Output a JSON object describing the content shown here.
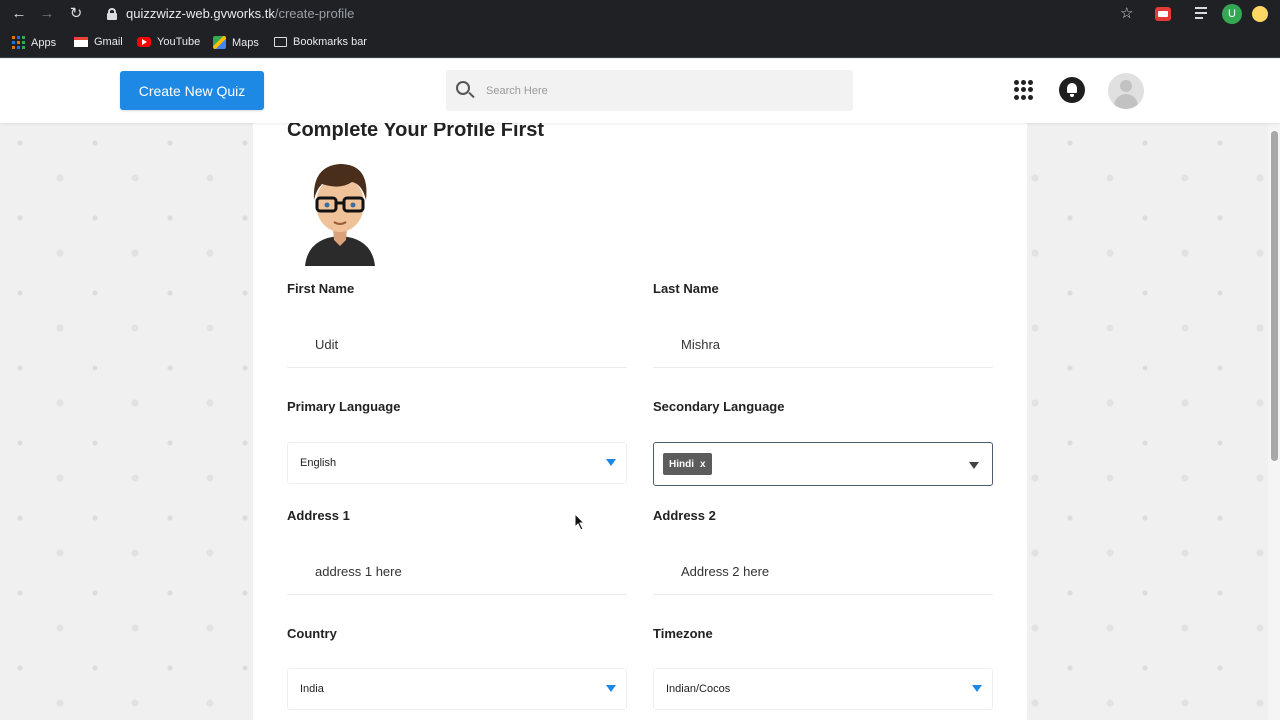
{
  "browser": {
    "url_host": "quizzwizz-web.gvworks.tk",
    "url_path": "/create-profile",
    "profile_initial": "U",
    "bookmarks": [
      {
        "label": "Apps",
        "icon": "apps-grid-icon"
      },
      {
        "label": "Gmail",
        "icon": "gmail-icon"
      },
      {
        "label": "YouTube",
        "icon": "youtube-icon"
      },
      {
        "label": "Maps",
        "icon": "maps-icon"
      },
      {
        "label": "Bookmarks bar",
        "icon": "folder-icon"
      }
    ]
  },
  "header": {
    "create_button": "Create New Quiz",
    "search_placeholder": "Search Here"
  },
  "form": {
    "title": "Complete Your Profile First",
    "first_name": {
      "label": "First Name",
      "value": "Udit"
    },
    "last_name": {
      "label": "Last Name",
      "value": "Mishra"
    },
    "primary_language": {
      "label": "Primary Language",
      "value": "English"
    },
    "secondary_language": {
      "label": "Secondary Language",
      "chip": "Hindi",
      "chip_remove": "x"
    },
    "address1": {
      "label": "Address 1",
      "value": "address 1 here"
    },
    "address2": {
      "label": "Address 2",
      "value": "Address 2 here"
    },
    "country": {
      "label": "Country",
      "value": "India"
    },
    "timezone": {
      "label": "Timezone",
      "value": "Indian/Cocos"
    }
  },
  "colors": {
    "accent": "#1e88e5",
    "chrome": "#202124"
  }
}
